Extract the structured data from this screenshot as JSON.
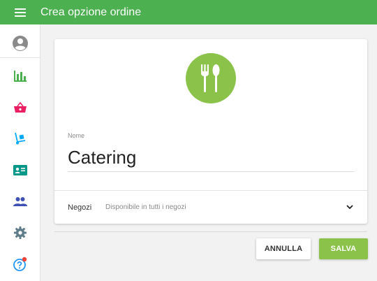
{
  "header": {
    "title": "Crea opzione ordine",
    "menu_icon": "hamburger-menu-icon",
    "background_color": "#4caf50"
  },
  "sidebar": {
    "items": [
      {
        "icon": "account-circle-icon",
        "color": "#8a8a8a"
      },
      {
        "icon": "bar-chart-icon",
        "color": "#4caf50"
      },
      {
        "icon": "shopping-basket-icon",
        "color": "#e91e63"
      },
      {
        "icon": "hand-truck-icon",
        "color": "#03a9f4"
      },
      {
        "icon": "contact-card-icon",
        "color": "#009688"
      },
      {
        "icon": "people-icon",
        "color": "#3f51b5"
      },
      {
        "icon": "settings-gear-icon",
        "color": "#607d8b"
      },
      {
        "icon": "help-icon",
        "color": "#2196f3",
        "notification_dot_color": "#f44336"
      }
    ]
  },
  "form": {
    "hero_icon": "fork-spoon-icon",
    "hero_color": "#8bc34a",
    "name_label": "Nome",
    "name_value": "Catering",
    "stores_label": "Negozi",
    "stores_value": "Disponibile in tutti i negozi",
    "stores_dropdown_icon": "chevron-down-icon"
  },
  "actions": {
    "cancel_label": "ANNULLA",
    "save_label": "SALVA",
    "save_color": "#8bc34a"
  }
}
